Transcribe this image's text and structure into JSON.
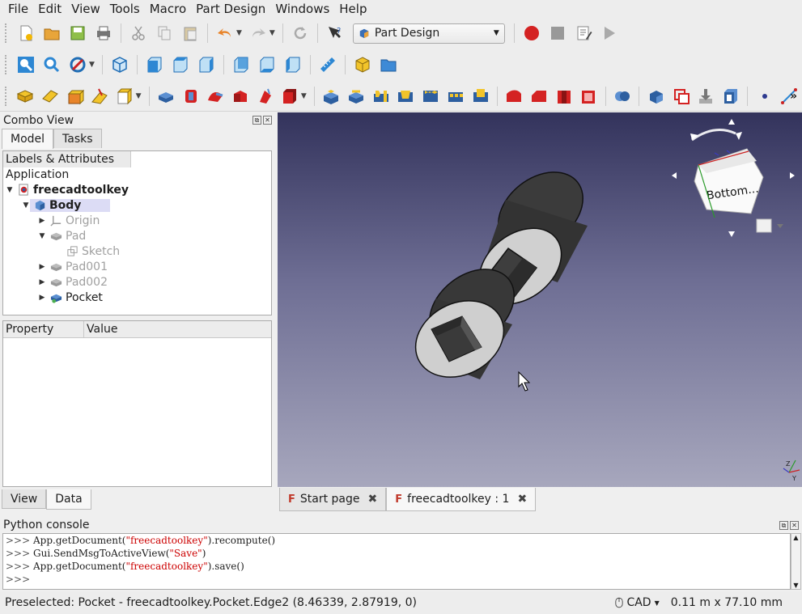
{
  "menubar": {
    "items": [
      "File",
      "Edit",
      "View",
      "Tools",
      "Macro",
      "Part Design",
      "Windows",
      "Help"
    ]
  },
  "toolbar": {
    "workbench": "Part Design"
  },
  "combo_view": {
    "title": "Combo View",
    "tabs": [
      "Model",
      "Tasks"
    ],
    "tree_header": "Labels & Attributes",
    "section": "Application",
    "document": "freecadtoolkey",
    "items": [
      "Body",
      "Origin",
      "Pad",
      "Sketch",
      "Pad001",
      "Pad002",
      "Pocket"
    ],
    "property_headers": [
      "Property",
      "Value"
    ],
    "bottom_tabs": [
      "View",
      "Data"
    ]
  },
  "viewport": {
    "nav_cube_face": "Bottom..."
  },
  "doc_tabs": [
    "Start page",
    "freecadtoolkey : 1"
  ],
  "python_console": {
    "title": "Python console",
    "prompt": ">>>",
    "lines": [
      {
        "pre": "App.getDocument(",
        "str": "\"freecadtoolkey\"",
        "post": ").recompute()"
      },
      {
        "pre": "Gui.SendMsgToActiveView(",
        "str": "\"Save\"",
        "post": ")"
      },
      {
        "pre": "App.getDocument(",
        "str": "\"freecadtoolkey\"",
        "post": ").save()"
      }
    ]
  },
  "statusbar": {
    "message": "Preselected: Pocket - freecadtoolkey.Pocket.Edge2 (8.46339, 2.87919, 0)",
    "nav_style": "CAD",
    "dimensions": "0.11 m x 77.10 mm"
  },
  "colors": {
    "viewport_top": "#33335c",
    "viewport_bottom": "#a7a7bd",
    "record": "#d42222",
    "string_literal": "#cc0000"
  }
}
